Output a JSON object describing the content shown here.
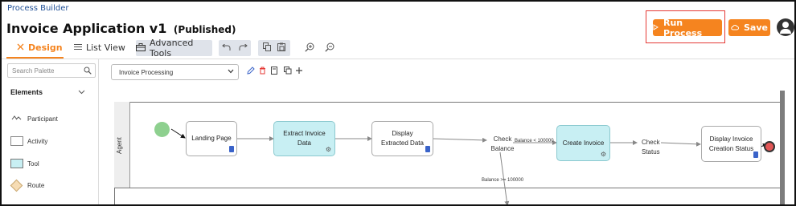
{
  "header": {
    "brand": "Process Builder",
    "app_title": "Invoice Application v1",
    "status": "(Published)",
    "run_label": "Run Process",
    "save_label": "Save",
    "colors": {
      "accent": "#f5841f",
      "highlight": "#e53935",
      "brand_text": "#1f4f96"
    }
  },
  "tabs": [
    {
      "label": "Design",
      "active": true,
      "icon": "design-icon"
    },
    {
      "label": "List View",
      "active": false,
      "icon": "list-icon"
    }
  ],
  "toolbar": {
    "advanced_tools_label": "Advanced Tools",
    "icons": [
      "toolbox-icon",
      "undo-icon",
      "redo-icon",
      "copy-icon",
      "paste-icon",
      "zoom-in-icon",
      "zoom-out-icon"
    ]
  },
  "sidebar": {
    "search_placeholder": "Search Palette",
    "elements_header": "Elements",
    "items": [
      {
        "label": "Participant",
        "icon": "participant-icon"
      },
      {
        "label": "Activity",
        "icon": "activity-shape"
      },
      {
        "label": "Tool",
        "icon": "tool-shape"
      },
      {
        "label": "Route",
        "icon": "route-shape"
      }
    ]
  },
  "canvas_toolbar": {
    "process_select": "Invoice Processing",
    "icons": [
      "edit-icon",
      "delete-icon",
      "page-icon",
      "duplicate-icon",
      "add-icon"
    ]
  },
  "diagram": {
    "lane_label": "Agent",
    "nodes": [
      {
        "id": "landing",
        "label": "Landing Page",
        "kind": "activity"
      },
      {
        "id": "extract",
        "label": "Extract Invoice Data",
        "kind": "tool"
      },
      {
        "id": "display",
        "label": "Display Extracted Data",
        "kind": "activity"
      },
      {
        "id": "check_balance",
        "label": "Check Balance",
        "kind": "route"
      },
      {
        "id": "create",
        "label": "Create Invoice",
        "kind": "tool"
      },
      {
        "id": "check_status",
        "label": "Check Status",
        "kind": "route"
      },
      {
        "id": "display_status",
        "label": "Display Invoice Creation Status",
        "kind": "activity"
      }
    ],
    "edge_labels": {
      "balance_lt": "Balance < 100000",
      "balance_ge": "Balance >= 100000"
    }
  }
}
